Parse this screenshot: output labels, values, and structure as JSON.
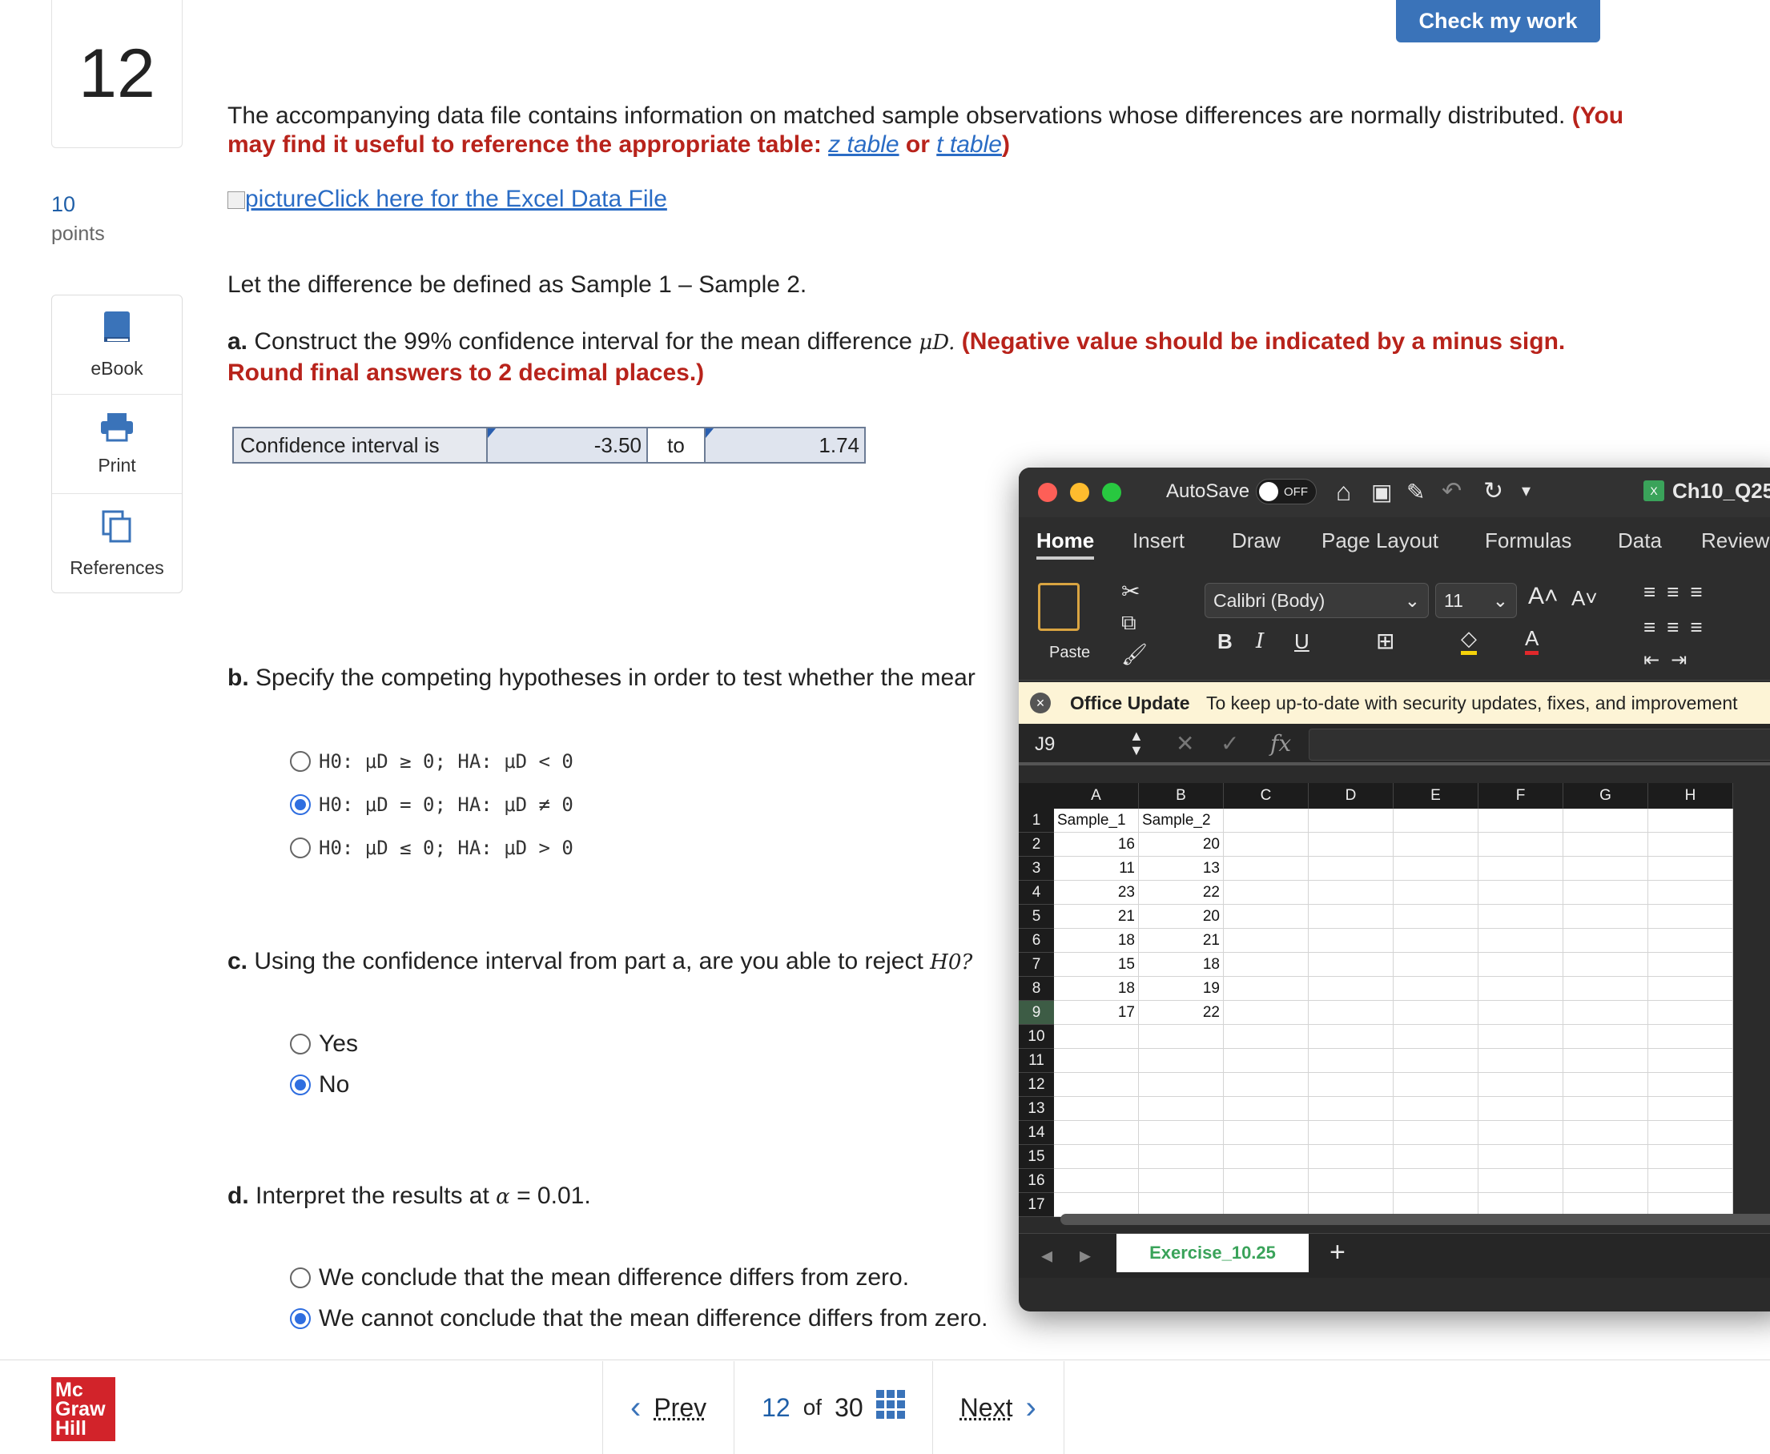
{
  "question": {
    "number": "12",
    "points_value": "10",
    "points_label": "points"
  },
  "tools": [
    {
      "label": "eBook",
      "icon": "book-icon"
    },
    {
      "label": "Print",
      "icon": "printer-icon"
    },
    {
      "label": "References",
      "icon": "copy-icon"
    }
  ],
  "header": {
    "check_button": "Check my work"
  },
  "body": {
    "intro_1": "The accompanying data file contains information on matched sample observations whose differences are normally distributed.",
    "intro_ref_pre": "(You may find it useful to reference the appropriate table:",
    "z_table_link": "z table",
    "intro_or": "or",
    "t_table_link": "t table",
    "intro_close": ")",
    "excel_link": "pictureClick here for the Excel Data File",
    "diff_def": "Let the difference be defined as Sample 1 – Sample 2.",
    "part_a_label": "a.",
    "part_a_text": "Construct the 99% confidence interval for the mean difference",
    "mu_d": "μD.",
    "part_a_instr": "(Negative value should be indicated by a minus sign. Round final answers to 2 decimal places.)",
    "ci_label": "Confidence interval is",
    "ci_low": "-3.50",
    "ci_to": "to",
    "ci_high": "1.74",
    "part_b_label": "b.",
    "part_b_text": "Specify the competing hypotheses in order to test whether the mear",
    "hypotheses": [
      {
        "text": "H0: μD ≥ 0; HA: μD < 0",
        "selected": false
      },
      {
        "text": "H0: μD = 0; HA: μD ≠ 0",
        "selected": true
      },
      {
        "text": "H0: μD ≤ 0; HA: μD > 0",
        "selected": false
      }
    ],
    "part_c_label": "c.",
    "part_c_text": "Using the confidence interval from part a, are you able to reject",
    "h0_q": "H0?",
    "part_c_options": [
      {
        "text": "Yes",
        "selected": false
      },
      {
        "text": "No",
        "selected": true
      }
    ],
    "part_d_label": "d.",
    "part_d_text": "Interpret the results at",
    "alpha": "α",
    "alpha_val": "= 0.01.",
    "part_d_options": [
      {
        "text": "We conclude that the mean difference differs from zero.",
        "selected": false
      },
      {
        "text": "We cannot conclude that the mean difference differs from zero.",
        "selected": true
      }
    ]
  },
  "footer": {
    "logo": [
      "Mc",
      "Graw",
      "Hill"
    ],
    "prev": "Prev",
    "current": "12",
    "of": "of",
    "total": "30",
    "next": "Next"
  },
  "excel": {
    "autosave": "AutoSave",
    "autosave_state": "OFF",
    "filename": "Ch10_Q25",
    "tabs": [
      "Home",
      "Insert",
      "Draw",
      "Page Layout",
      "Formulas",
      "Data",
      "Review"
    ],
    "active_tab": "Home",
    "paste": "Paste",
    "font_name": "Calibri (Body)",
    "font_size": "11",
    "update_title": "Office Update",
    "update_text": "To keep up-to-date with security updates, fixes, and improvement",
    "name_box": "J9",
    "fx": "fx",
    "columns": [
      "A",
      "B",
      "C",
      "D",
      "E",
      "F",
      "G",
      "H"
    ],
    "rows": [
      "1",
      "2",
      "3",
      "4",
      "5",
      "6",
      "7",
      "8",
      "9",
      "10",
      "11",
      "12",
      "13",
      "14",
      "15",
      "16",
      "17"
    ],
    "data": [
      [
        "Sample_1",
        "Sample_2"
      ],
      [
        "16",
        "20"
      ],
      [
        "11",
        "13"
      ],
      [
        "23",
        "22"
      ],
      [
        "21",
        "20"
      ],
      [
        "18",
        "21"
      ],
      [
        "15",
        "18"
      ],
      [
        "18",
        "19"
      ],
      [
        "17",
        "22"
      ]
    ],
    "sheet_tab": "Exercise_10.25",
    "add_sheet": "+"
  },
  "colors": {
    "accent": "#3a73b9",
    "instruction_red": "#b8231b",
    "link": "#2a6cc5",
    "radio": "#2f6ee0",
    "logo_red": "#d2232a",
    "excel_green": "#3aa35a"
  }
}
